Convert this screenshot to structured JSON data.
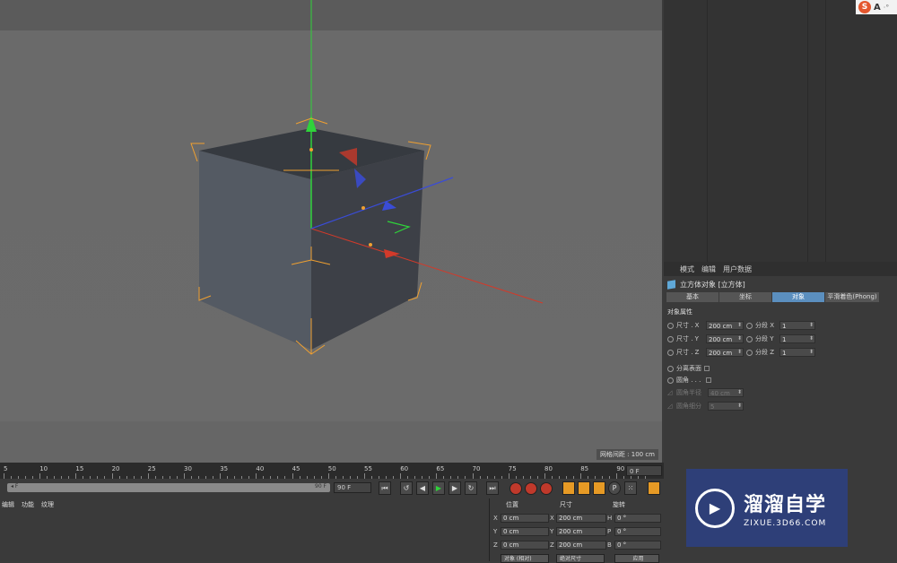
{
  "viewport": {
    "grid_spacing_label": "网格间距 : 100 cm"
  },
  "logo": {
    "s": "S",
    "a": "A",
    "rest": "·°"
  },
  "attributes": {
    "menu": [
      "模式",
      "编辑",
      "用户数据"
    ],
    "object_title": "立方体对象 [立方体]",
    "tabs": [
      "基本",
      "坐标",
      "对象",
      "平滑着色(Phong)"
    ],
    "section": "对象属性",
    "size_x_label": "尺寸 . X",
    "size_y_label": "尺寸 . Y",
    "size_z_label": "尺寸 . Z",
    "size_x": "200 cm",
    "size_y": "200 cm",
    "size_z": "200 cm",
    "seg_x_label": "分段 X",
    "seg_y_label": "分段 Y",
    "seg_z_label": "分段 Z",
    "seg_x": "1",
    "seg_y": "1",
    "seg_z": "1",
    "separate_label": "分离表面",
    "fillet_label": "圆角 . . .",
    "fillet_radius_label": "圆角半径",
    "fillet_radius": "40 cm",
    "fillet_sub_label": "圆角细分",
    "fillet_sub": "5"
  },
  "timeline": {
    "ticks": [
      "5",
      "10",
      "15",
      "20",
      "25",
      "30",
      "35",
      "40",
      "45",
      "50",
      "55",
      "60",
      "65",
      "70",
      "75",
      "80",
      "85",
      "90"
    ],
    "current_frame": "0 F",
    "range_start": "◂ F",
    "range_end": "90 F",
    "end_frame_field": "90 F"
  },
  "material_menu": [
    "编辑",
    "功能",
    "纹理"
  ],
  "coordinates": {
    "headers": [
      "位置",
      "尺寸",
      "旋转"
    ],
    "rows": [
      {
        "axis": "X",
        "pos": "0 cm",
        "size_axis": "X",
        "size": "200 cm",
        "rot_axis": "H",
        "rot": "0 °"
      },
      {
        "axis": "Y",
        "pos": "0 cm",
        "size_axis": "Y",
        "size": "200 cm",
        "rot_axis": "P",
        "rot": "0 °"
      },
      {
        "axis": "Z",
        "pos": "0 cm",
        "size_axis": "Z",
        "size": "200 cm",
        "rot_axis": "B",
        "rot": "0 °"
      }
    ],
    "mode_object": "对象 (相对)",
    "mode_size": "绝对尺寸",
    "apply": "应用"
  },
  "watermark": {
    "title": "溜溜自学",
    "url": "ZIXUE.3D66.COM"
  },
  "colors": {
    "cube_face_front": "#454a52",
    "cube_top": "#3a3d42",
    "axis_x": "#d23a2a",
    "axis_y": "#2fd33a",
    "axis_z": "#3a4cd6",
    "bbox_orange": "#f0a030",
    "tab_active": "#5b8fbf"
  }
}
